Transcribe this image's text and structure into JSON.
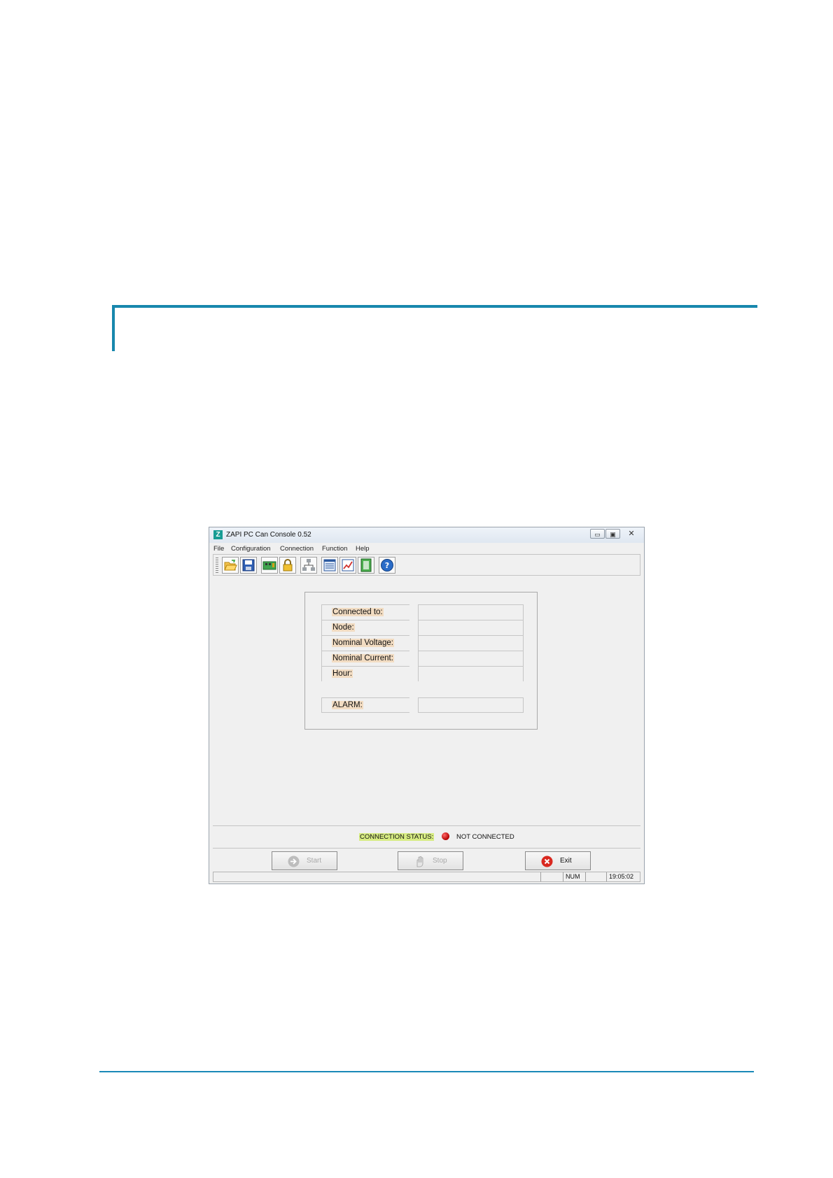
{
  "window": {
    "title": "ZAPI PC Can Console 0.52",
    "app_icon_letter": "Z",
    "controls": {
      "minimize": "▭",
      "maximize": "▣",
      "close": "✕"
    }
  },
  "menu": [
    "File",
    "Configuration",
    "Connection",
    "Function",
    "Help"
  ],
  "toolbar": {
    "buttons": [
      "open-folder-icon",
      "save-disk-icon",
      "controller-board-icon",
      "lock-icon",
      "network-icon",
      "list-view-icon",
      "chart-icon",
      "notebook-icon",
      "help-icon"
    ]
  },
  "info_panel": {
    "connected_label": "Connected to:",
    "connected_value": "",
    "node_label": "Node:",
    "node_value": "",
    "voltage_label": "Nominal Voltage:",
    "voltage_value": "",
    "current_label": "Nominal Current:",
    "current_value": "",
    "hour_label": "Hour:",
    "hour_value": "",
    "alarm_label": "ALARM:",
    "alarm_value": ""
  },
  "connection": {
    "label": "CONNECTION STATUS:",
    "value": "NOT CONNECTED",
    "indicator_color": "#c00000"
  },
  "buttons": {
    "start": "Start",
    "stop": "Stop",
    "exit": "Exit"
  },
  "statusbar": {
    "num": "NUM",
    "time": "19:05:02"
  },
  "colors": {
    "accent": "#1787ad",
    "label_highlight": "#f2dcc2",
    "status_highlight": "#d7ec82"
  }
}
